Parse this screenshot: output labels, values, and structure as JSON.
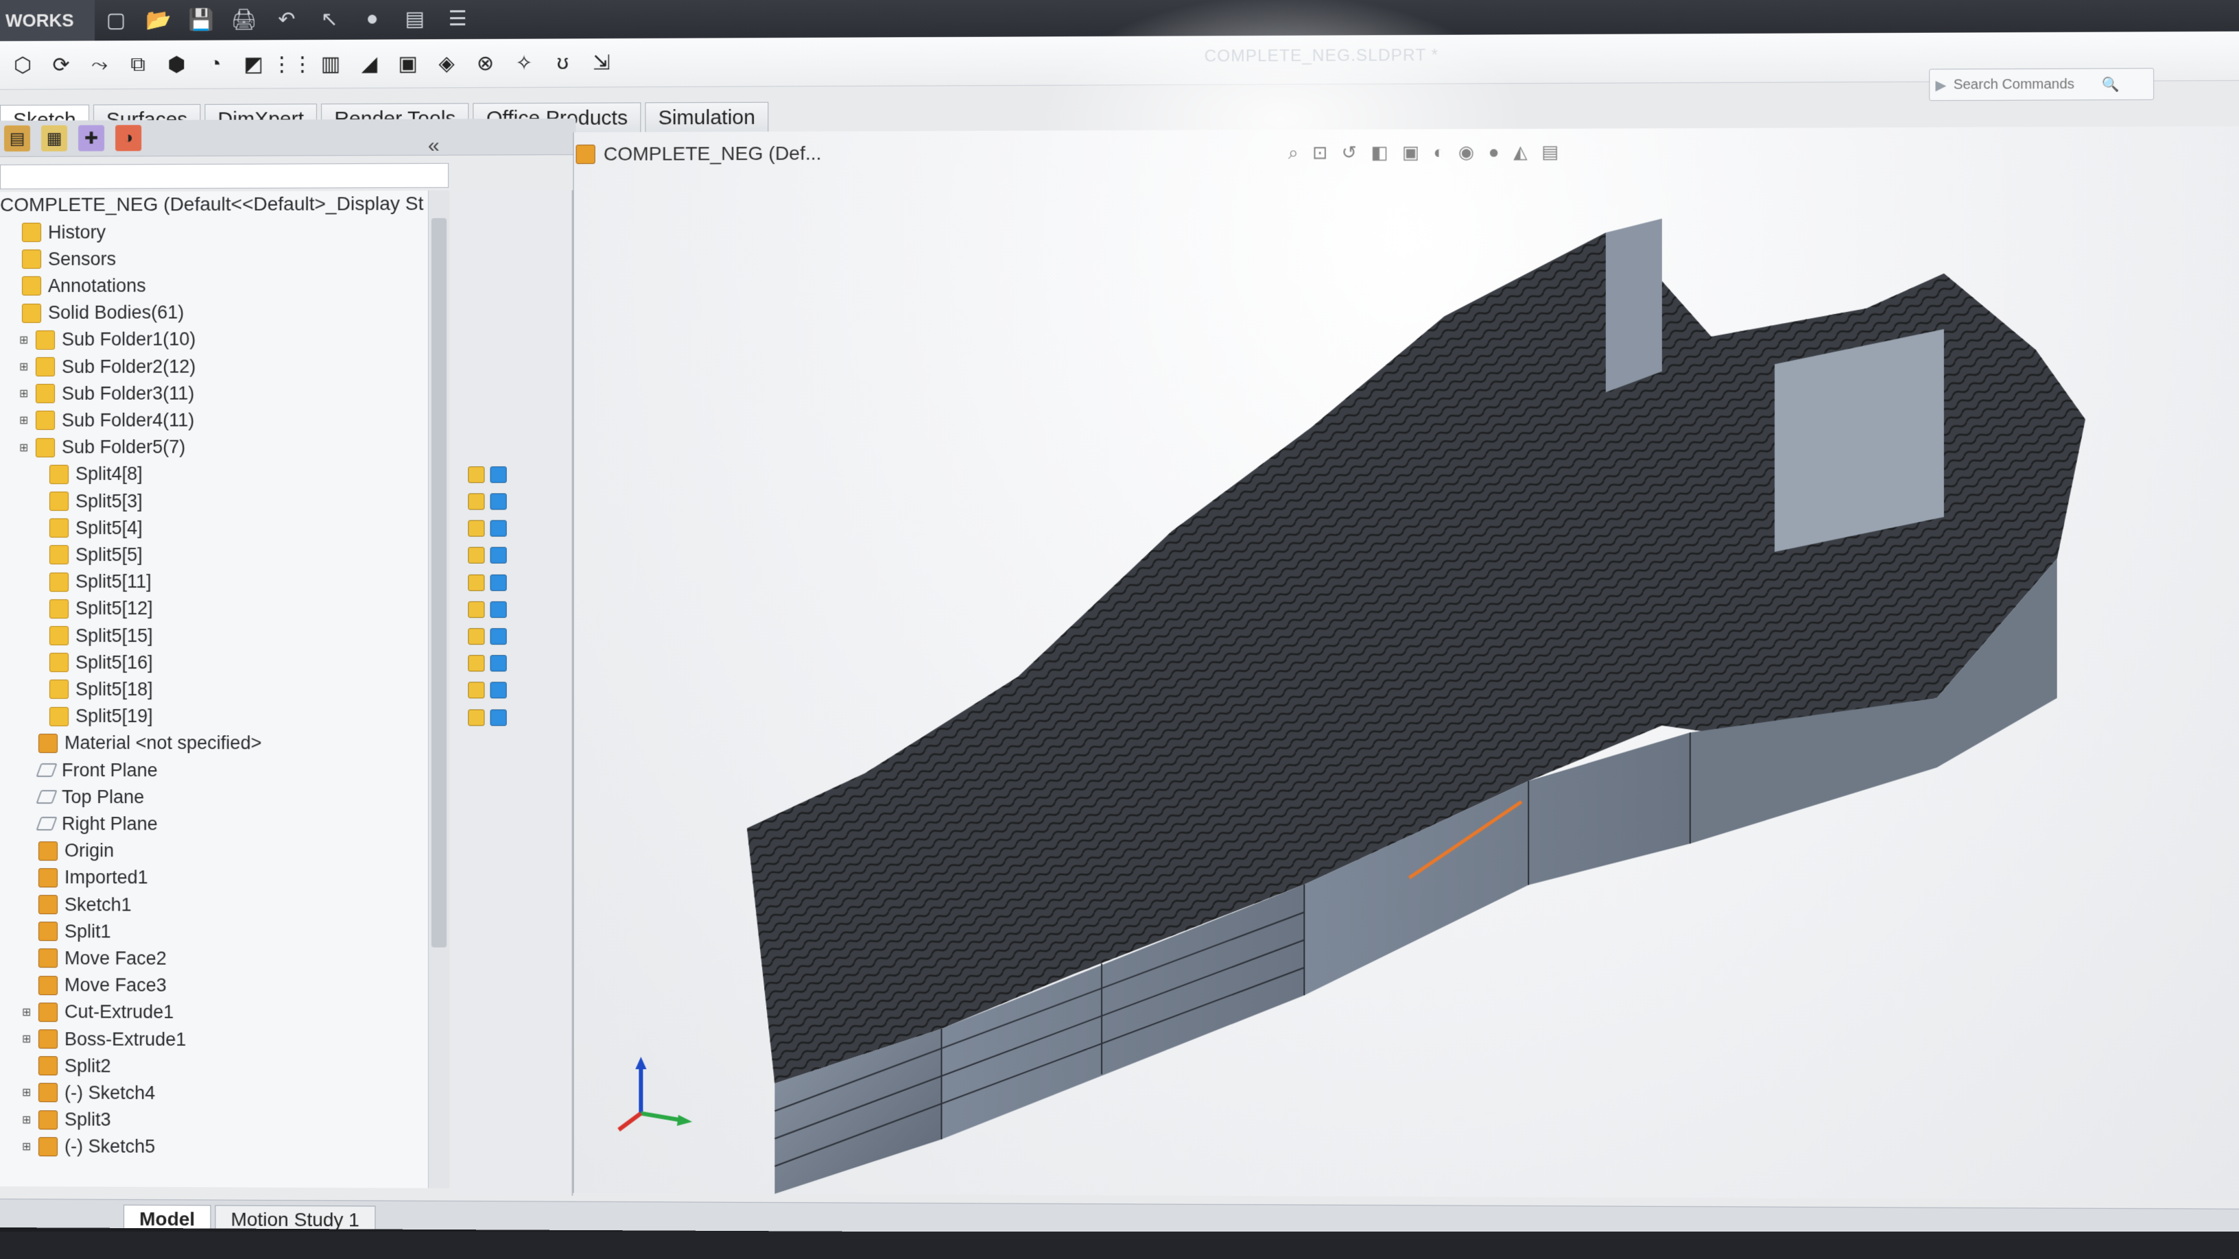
{
  "app": {
    "logo_text": "WORKS",
    "document_title": "COMPLETE_NEG.SLDPRT *"
  },
  "search": {
    "placeholder": "Search Commands"
  },
  "command_tabs": [
    {
      "label": "Sketch",
      "active": true
    },
    {
      "label": "Surfaces"
    },
    {
      "label": "DimXpert"
    },
    {
      "label": "Render Tools"
    },
    {
      "label": "Office Products"
    },
    {
      "label": "Simulation"
    }
  ],
  "feature_tree": {
    "root": "COMPLETE_NEG  (Default<<Default>_Display St",
    "items": [
      {
        "label": "History",
        "icon": "history-icon"
      },
      {
        "label": "Sensors",
        "icon": "sensor-icon"
      },
      {
        "label": "Annotations",
        "icon": "annotation-icon"
      },
      {
        "label": "Solid Bodies(61)",
        "icon": "solid-bodies-icon"
      },
      {
        "label": "Sub Folder1(10)",
        "icon": "folder-icon"
      },
      {
        "label": "Sub Folder2(12)",
        "icon": "folder-icon"
      },
      {
        "label": "Sub Folder3(11)",
        "icon": "folder-icon"
      },
      {
        "label": "Sub Folder4(11)",
        "icon": "folder-icon"
      },
      {
        "label": "Sub Folder5(7)",
        "icon": "folder-icon"
      },
      {
        "label": "Split4[8]",
        "icon": "body-icon"
      },
      {
        "label": "Split5[3]",
        "icon": "body-icon"
      },
      {
        "label": "Split5[4]",
        "icon": "body-icon"
      },
      {
        "label": "Split5[5]",
        "icon": "body-icon"
      },
      {
        "label": "Split5[11]",
        "icon": "body-icon"
      },
      {
        "label": "Split5[12]",
        "icon": "body-icon"
      },
      {
        "label": "Split5[15]",
        "icon": "body-icon"
      },
      {
        "label": "Split5[16]",
        "icon": "body-icon"
      },
      {
        "label": "Split5[18]",
        "icon": "body-icon"
      },
      {
        "label": "Split5[19]",
        "icon": "body-icon"
      },
      {
        "label": "Material <not specified>",
        "icon": "material-icon"
      },
      {
        "label": "Front Plane",
        "icon": "plane-icon"
      },
      {
        "label": "Top Plane",
        "icon": "plane-icon"
      },
      {
        "label": "Right Plane",
        "icon": "plane-icon"
      },
      {
        "label": "Origin",
        "icon": "origin-icon"
      },
      {
        "label": "Imported1",
        "icon": "imported-icon"
      },
      {
        "label": "Sketch1",
        "icon": "sketch-icon"
      },
      {
        "label": "Split1",
        "icon": "split-icon"
      },
      {
        "label": "Move Face2",
        "icon": "move-face-icon"
      },
      {
        "label": "Move Face3",
        "icon": "move-face-icon"
      },
      {
        "label": "Cut-Extrude1",
        "icon": "cut-extrude-icon"
      },
      {
        "label": "Boss-Extrude1",
        "icon": "boss-extrude-icon"
      },
      {
        "label": "Split2",
        "icon": "split-icon"
      },
      {
        "label": "(-) Sketch4",
        "icon": "sketch-icon"
      },
      {
        "label": "Split3",
        "icon": "split-icon"
      },
      {
        "label": "(-) Sketch5",
        "icon": "sketch-icon"
      }
    ]
  },
  "viewport": {
    "title": "COMPLETE_NEG  (Def..."
  },
  "bottom_tabs": [
    {
      "label": "Model",
      "active": true
    },
    {
      "label": "Motion Study 1"
    }
  ]
}
